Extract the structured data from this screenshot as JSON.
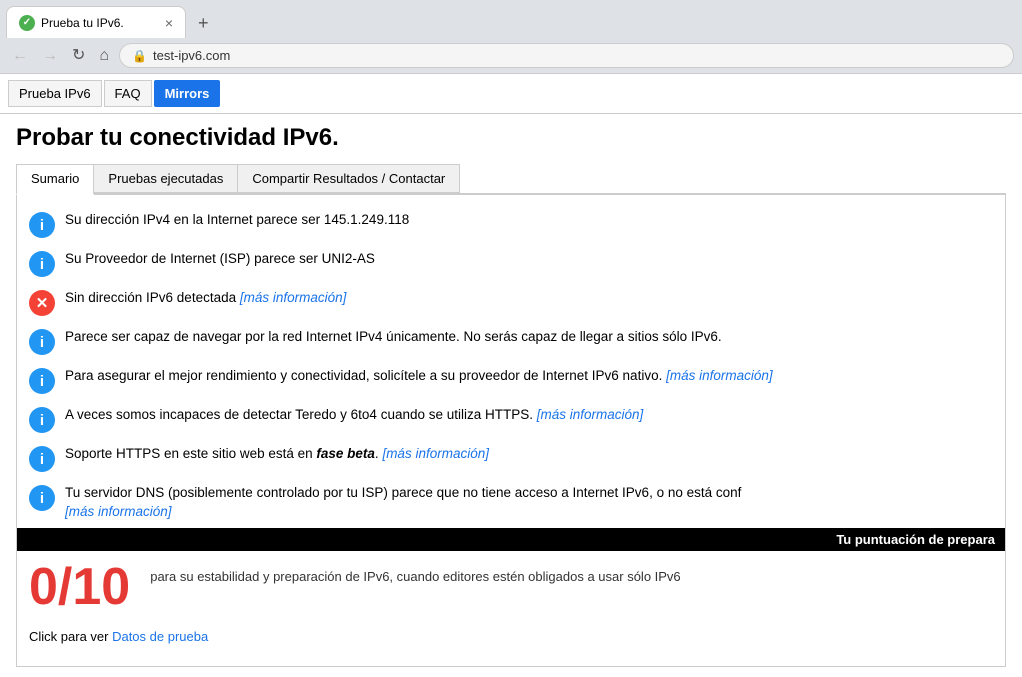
{
  "browser": {
    "tab": {
      "title": "Prueba tu IPv6.",
      "close": "×",
      "new_tab": "+"
    },
    "address": "test-ipv6.com",
    "nav": {
      "back": "←",
      "forward": "→",
      "refresh": "↻",
      "home": "⌂"
    }
  },
  "site_nav": {
    "tabs": [
      {
        "label": "Prueba IPv6",
        "active": false,
        "plain": true
      },
      {
        "label": "FAQ",
        "active": false,
        "plain": true
      },
      {
        "label": "Mirrors",
        "active": true,
        "plain": false
      }
    ]
  },
  "page": {
    "title": "Probar tu conectividad IPv6.",
    "content_tabs": [
      {
        "label": "Sumario",
        "active": true
      },
      {
        "label": "Pruebas ejecutadas",
        "active": false
      },
      {
        "label": "Compartir Resultados / Contactar",
        "active": false
      }
    ],
    "results": [
      {
        "type": "info",
        "text": "Su dirección IPv4 en la Internet parece ser 145.1.249.118",
        "link": null
      },
      {
        "type": "info",
        "text": "Su Proveedor de Internet (ISP) parece ser UNI2-AS",
        "link": null
      },
      {
        "type": "error",
        "text": "Sin dirección IPv6 detectada ",
        "link": "[más información]"
      },
      {
        "type": "info",
        "text": "Parece ser capaz de navegar por la red Internet IPv4 únicamente. No serás capaz de llegar a sitios sólo IPv6.",
        "link": null
      },
      {
        "type": "info",
        "text": "Para asegurar el mejor rendimiento y conectividad, solicítele a su proveedor de Internet IPv6 nativo. ",
        "link": "[más información]"
      },
      {
        "type": "info",
        "text": "A veces somos incapaces de detectar Teredo y 6to4 cuando se utiliza HTTPS. ",
        "link": "[más información]"
      },
      {
        "type": "info",
        "text_before": "Soporte HTTPS en este sitio web está en ",
        "text_bold_italic": "fase beta",
        "text_after": ". ",
        "link": "[más información]",
        "special": true
      },
      {
        "type": "info",
        "text": "Tu servidor DNS (posiblemente controlado por tu ISP) parece que no tiene acceso a Internet IPv6, o no está conf",
        "link": "[más información]"
      }
    ],
    "score_bar_label": "Tu puntuación de prepara",
    "score": "0/10",
    "score_description": "para su estabilidad y preparación de IPv6, cuando editores estén obligados a usar sólo IPv6",
    "datos_prefix": "Click para ver ",
    "datos_link": "Datos de prueba"
  }
}
